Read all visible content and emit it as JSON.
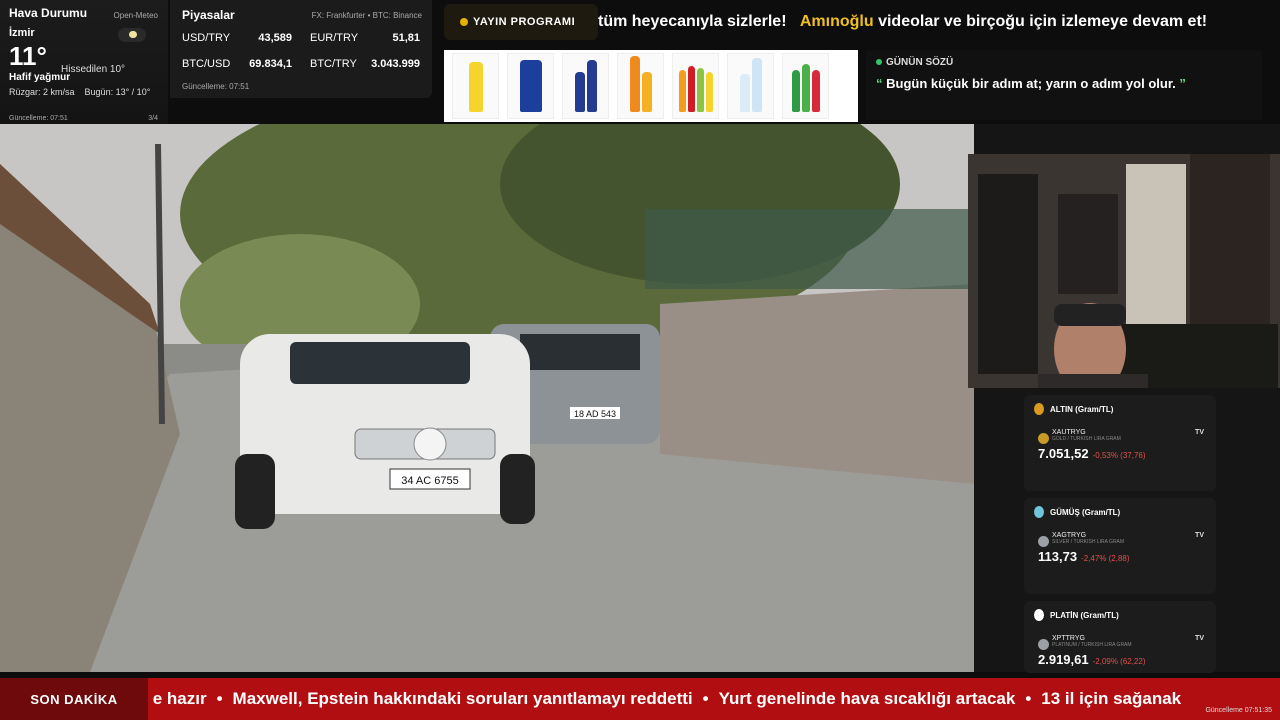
{
  "weather": {
    "title": "Hava Durumu",
    "source": "Open-Meteo",
    "city": "İzmir",
    "temp": "11°",
    "feels_like": "Hissedilen 10°",
    "condition": "Hafif yağmur",
    "wind": "Rüzgar:  2 km/sa",
    "today": "Bugün:  13° / 10°",
    "updated": "Güncelleme: 07:51",
    "page": "3/4",
    "icon": "cloud-rain-icon"
  },
  "markets": {
    "title": "Piyasalar",
    "source": "FX: Frankfurter • BTC: Binance",
    "items": [
      {
        "label": "USD/TRY",
        "value": "43,589"
      },
      {
        "label": "EUR/TRY",
        "value": "51,81"
      },
      {
        "label": "BTC/USD",
        "value": "69.834,1"
      },
      {
        "label": "BTC/TRY",
        "value": "3.043.999"
      }
    ],
    "updated": "Güncelleme: 07:51"
  },
  "program_button": "YAYIN PROGRAMI",
  "top_ticker": {
    "part1": "tüm heyecanıyla sizlerle!",
    "highlight": "Amınoğlu",
    "part2": " videolar ve birçoğu için izlemeye devam et!"
  },
  "quote": {
    "label": "GÜNÜN SÖZÜ",
    "open": "“",
    "text": " Bugün küçük bir adım at; yarın o adım yol olur. ",
    "close": "”"
  },
  "video": {
    "plate_front": "34 AC 6755",
    "plate_back": "18 AD 543"
  },
  "commodities": [
    {
      "title": "ALTIN (Gram/TL)",
      "symbol": "XAUTRYG",
      "sub": "GOLD / TURKISH LIRA GRAM",
      "value": "7.051,52",
      "change": "-0,53% (37,76)",
      "medal": "#d99a1f"
    },
    {
      "title": "GÜMÜŞ (Gram/TL)",
      "symbol": "XAGTRYG",
      "sub": "SILVER / TURKISH LIRA GRAM",
      "value": "113,73",
      "change": "-2,47% (2,88)",
      "medal": "#6fc6d6"
    },
    {
      "title": "PLATİN (Gram/TL)",
      "symbol": "XPTTRYG",
      "sub": "PLATINUM / TURKISH LIRA GRAM",
      "value": "2.919,61",
      "change": "-2,09% (62,22)",
      "medal": "#ffffff"
    }
  ],
  "tv_logo": "TV",
  "breaking": {
    "label": "SON DAKİKA",
    "items": [
      "e hazır",
      "Maxwell, Epstein hakkındaki soruları yanıtlamayı reddetti",
      "Yurt genelinde hava sıcaklığı artacak",
      "13 il için sağanak"
    ],
    "separator": "•",
    "updated": "Güncelleme 07:51:35"
  },
  "colors": {
    "accent": "#f0c020",
    "breaking_bg": "#b10e12",
    "quote_green": "#5be07f",
    "negative": "#e0504a"
  }
}
